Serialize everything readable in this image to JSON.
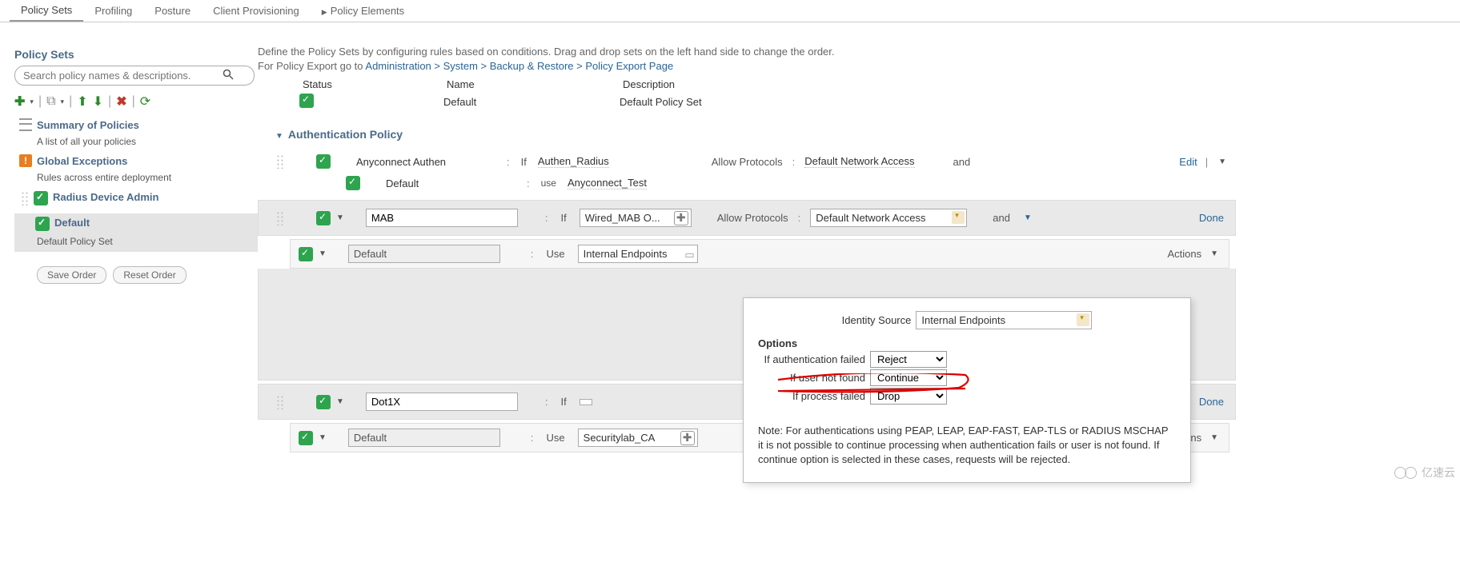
{
  "tabs": [
    "Policy Sets",
    "Profiling",
    "Posture",
    "Client Provisioning",
    "Policy Elements"
  ],
  "sidebar": {
    "title": "Policy Sets",
    "search_placeholder": "Search policy names & descriptions.",
    "summary": "Summary of Policies",
    "summary_sub": "A list of all your policies",
    "global": "Global Exceptions",
    "global_sub": "Rules across entire deployment",
    "radius": "Radius Device Admin",
    "default": "Default",
    "default_sub": "Default Policy Set",
    "save": "Save Order",
    "reset": "Reset Order"
  },
  "intro": {
    "line1": "Define the Policy Sets by configuring rules based on conditions. Drag and drop sets on the left hand side to change the order.",
    "line2a": "For Policy Export go to ",
    "link": "Administration > System > Backup & Restore > Policy Export Page"
  },
  "cols": {
    "status": "Status",
    "name": "Name",
    "desc": "Description"
  },
  "vals": {
    "name": "Default",
    "desc": "Default Policy Set"
  },
  "section": "Authentication Policy",
  "labels": {
    "if": "If",
    "use": "Use",
    "allow": "Allow Protocols",
    "and": "and",
    "edit": "Edit",
    "done": "Done",
    "actions": "Actions"
  },
  "row1": {
    "name": "Anyconnect Authen",
    "cond": "Authen_Radius",
    "proto": "Default Network Access",
    "sub_name": "Default",
    "sub_use": "Anyconnect_Test"
  },
  "row2": {
    "name": "MAB",
    "cond": "Wired_MAB O...",
    "proto": "Default Network Access",
    "sub_name": "Default",
    "sub_use": "Internal Endpoints"
  },
  "row3": {
    "name": "Dot1X",
    "sub_name": "Default",
    "sub_use": "Securitylab_CA"
  },
  "popup": {
    "id_src_lbl": "Identity Source",
    "id_src_val": "Internal Endpoints",
    "options": "Options",
    "auth_fail_lbl": "If authentication failed",
    "auth_fail_val": "Reject",
    "user_nf_lbl": "If user not found",
    "user_nf_val": "Continue",
    "proc_fail_lbl": "If process failed",
    "proc_fail_val": "Drop",
    "note": "Note: For authentications using PEAP, LEAP, EAP-FAST, EAP-TLS or RADIUS MSCHAP it is not possible to continue processing when authentication fails or user is not found. If continue option is selected in these cases, requests will be rejected."
  },
  "watermark": "亿速云"
}
